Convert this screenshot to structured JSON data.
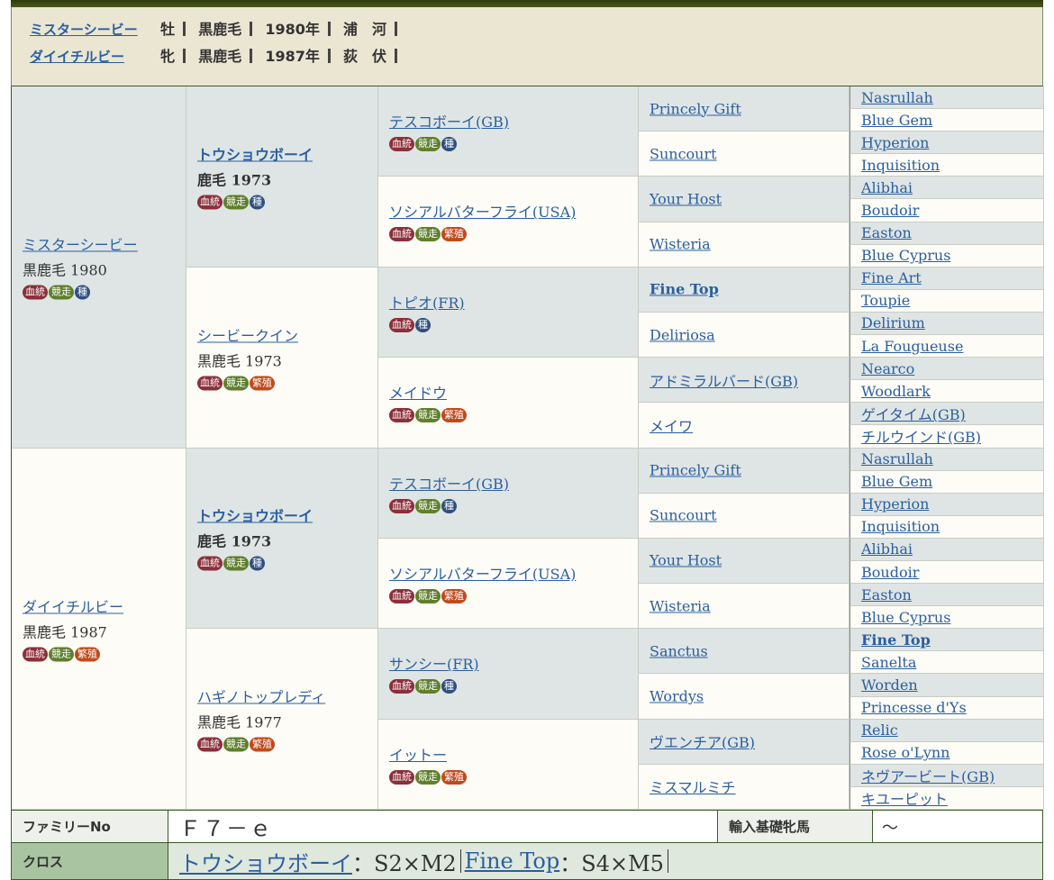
{
  "header": {
    "rows": [
      {
        "name": "ミスターシービー",
        "sex": "牡",
        "coat": "黒鹿毛",
        "year": "1980年",
        "place": "浦　河"
      },
      {
        "name": "ダイイチルビー",
        "sex": "牝",
        "coat": "黒鹿毛",
        "year": "1987年",
        "place": "荻　伏"
      }
    ]
  },
  "badge_labels": {
    "blood": "血統",
    "race": "競走",
    "sire": "種",
    "mare": "繁殖"
  },
  "colors": {
    "gray_cell": "#dfe5e4",
    "white_cell": "#fdfcf6",
    "header_bg": "#ebe6d2",
    "link": "#2a5fa0",
    "family_bg": "#eef0ec",
    "cross_bg": "#a8c4a0"
  },
  "gen1": [
    {
      "name": "ミスターシービー",
      "sub": "黒鹿毛 1980",
      "badges": [
        "blood",
        "race",
        "sire"
      ]
    },
    {
      "name": "ダイイチルビー",
      "sub": "黒鹿毛 1987",
      "badges": [
        "blood",
        "race",
        "mare"
      ]
    }
  ],
  "gen2": [
    {
      "name": "トウショウボーイ",
      "sub": "鹿毛 1973",
      "badges": [
        "blood",
        "race",
        "sire"
      ],
      "bold": true
    },
    {
      "name": "シービークイン",
      "sub": "黒鹿毛 1973",
      "badges": [
        "blood",
        "race",
        "mare"
      ]
    },
    {
      "name": "トウショウボーイ",
      "sub": "鹿毛 1973",
      "badges": [
        "blood",
        "race",
        "sire"
      ],
      "bold": true
    },
    {
      "name": "ハギノトップレディ",
      "sub": "黒鹿毛 1977",
      "badges": [
        "blood",
        "race",
        "mare"
      ]
    }
  ],
  "gen3": [
    {
      "name": "テスコボーイ(GB)",
      "badges": [
        "blood",
        "race",
        "sire"
      ]
    },
    {
      "name": "ソシアルバターフライ(USA)",
      "badges": [
        "blood",
        "race",
        "mare"
      ]
    },
    {
      "name": "トピオ(FR)",
      "badges": [
        "blood",
        "sire"
      ]
    },
    {
      "name": "メイドウ",
      "badges": [
        "blood",
        "race",
        "mare"
      ]
    },
    {
      "name": "テスコボーイ(GB)",
      "badges": [
        "blood",
        "race",
        "sire"
      ]
    },
    {
      "name": "ソシアルバターフライ(USA)",
      "badges": [
        "blood",
        "race",
        "mare"
      ]
    },
    {
      "name": "サンシー(FR)",
      "badges": [
        "blood",
        "race",
        "sire"
      ]
    },
    {
      "name": "イットー",
      "badges": [
        "blood",
        "race",
        "mare"
      ]
    }
  ],
  "gen4": [
    {
      "name": "Princely Gift"
    },
    {
      "name": "Suncourt"
    },
    {
      "name": "Your Host"
    },
    {
      "name": "Wisteria"
    },
    {
      "name": "Fine Top",
      "bold": true
    },
    {
      "name": "Deliriosa"
    },
    {
      "name": "アドミラルバード(GB)"
    },
    {
      "name": "メイワ"
    },
    {
      "name": "Princely Gift"
    },
    {
      "name": "Suncourt"
    },
    {
      "name": "Your Host"
    },
    {
      "name": "Wisteria"
    },
    {
      "name": "Sanctus"
    },
    {
      "name": "Wordys"
    },
    {
      "name": "ヴエンチア(GB)"
    },
    {
      "name": "ミスマルミチ"
    }
  ],
  "gen5": [
    {
      "name": "Nasrullah"
    },
    {
      "name": "Blue Gem"
    },
    {
      "name": "Hyperion"
    },
    {
      "name": "Inquisition"
    },
    {
      "name": "Alibhai"
    },
    {
      "name": "Boudoir"
    },
    {
      "name": "Easton"
    },
    {
      "name": "Blue Cyprus"
    },
    {
      "name": "Fine Art"
    },
    {
      "name": "Toupie"
    },
    {
      "name": "Delirium"
    },
    {
      "name": "La Fougueuse"
    },
    {
      "name": "Nearco"
    },
    {
      "name": "Woodlark"
    },
    {
      "name": "ゲイタイム(GB)"
    },
    {
      "name": "チルウインド(GB)"
    },
    {
      "name": "Nasrullah"
    },
    {
      "name": "Blue Gem"
    },
    {
      "name": "Hyperion"
    },
    {
      "name": "Inquisition"
    },
    {
      "name": "Alibhai"
    },
    {
      "name": "Boudoir"
    },
    {
      "name": "Easton"
    },
    {
      "name": "Blue Cyprus"
    },
    {
      "name": "Fine Top",
      "bold": true
    },
    {
      "name": "Sanelta"
    },
    {
      "name": "Worden"
    },
    {
      "name": "Princesse d'Ys"
    },
    {
      "name": "Relic"
    },
    {
      "name": "Rose o'Lynn"
    },
    {
      "name": "ネヴアービート(GB)"
    },
    {
      "name": "キユーピット"
    }
  ],
  "family": {
    "label": "ファミリーNo",
    "value": "Ｆ７－ｅ",
    "import_label": "輸入基礎牝馬",
    "import_value": "～"
  },
  "cross": {
    "label": "クロス",
    "items": [
      {
        "name": "トウショウボーイ",
        "value": "：S2×M2"
      },
      {
        "name": "Fine Top",
        "value": "：S4×M5"
      }
    ]
  }
}
